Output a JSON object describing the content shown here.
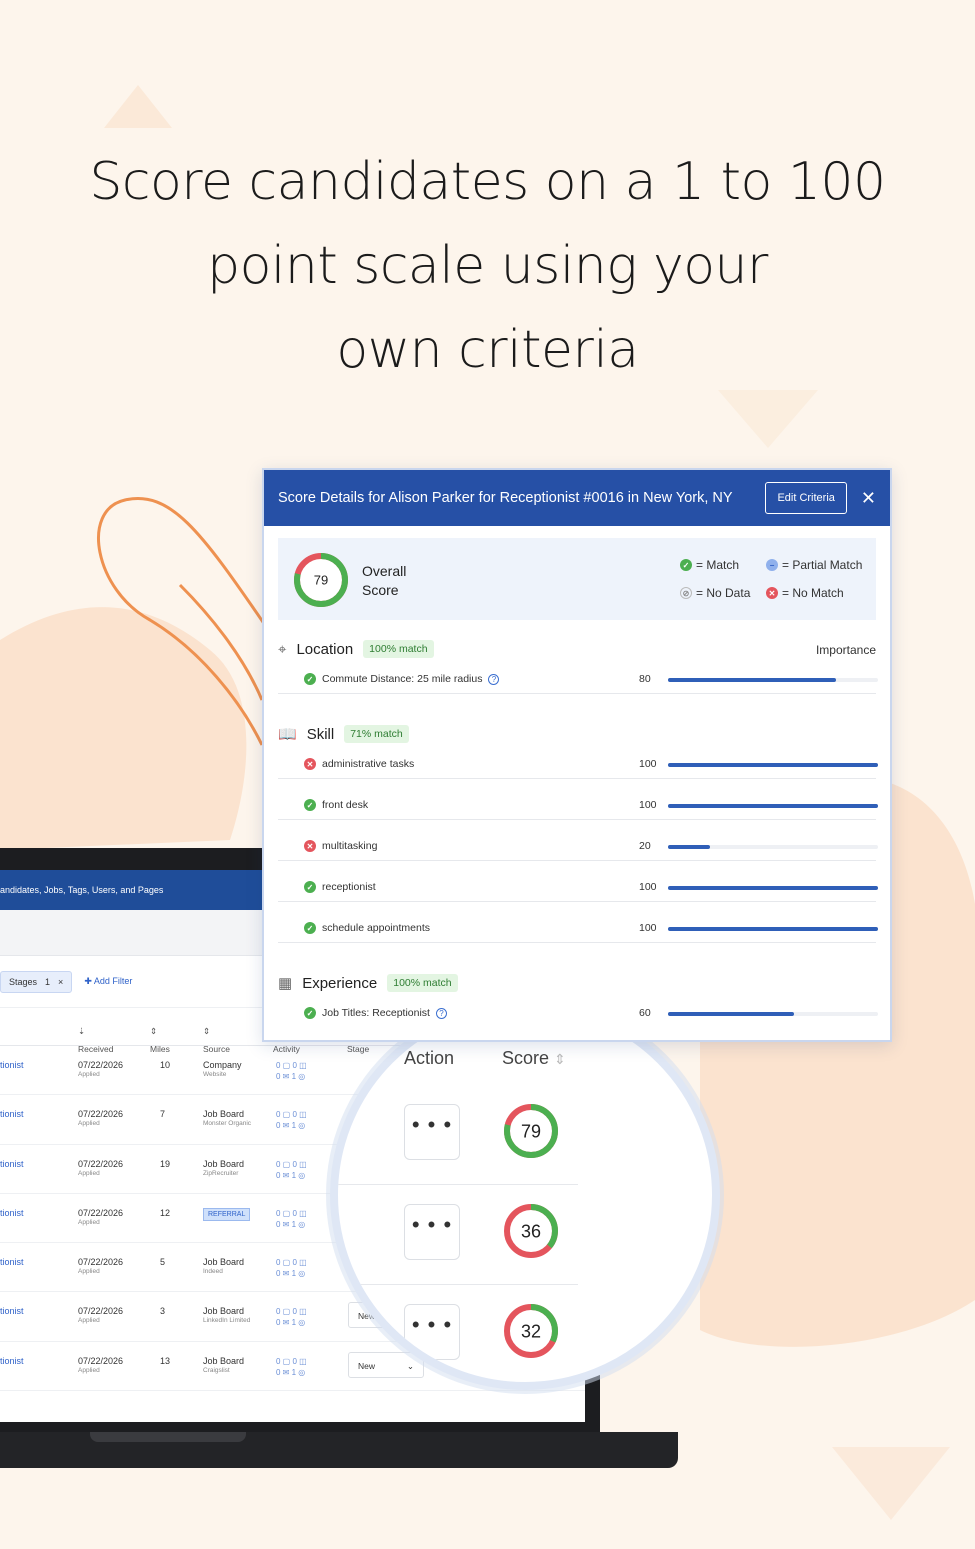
{
  "headline": {
    "line1": "Score candidates on a 1 to 100",
    "line2": "point scale using your",
    "line3": "own criteria"
  },
  "colors": {
    "primary": "#2650a6",
    "match": "#4caf50",
    "nomatch": "#e4555d",
    "background": "#fdf5ec",
    "accent_orange": "#ee9150"
  },
  "app": {
    "navbar_text": "andidates, Jobs, Tags, Users, and Pages",
    "linkedin_icon": "in",
    "filter_chip_label": "Stages",
    "filter_chip_count": "1",
    "filter_chip_close": "×",
    "add_filter": "Add Filter",
    "columns": {
      "received": "Received",
      "miles": "Miles",
      "source": "Source",
      "activity": "Activity",
      "stage": "Stage"
    },
    "rows": [
      {
        "job": "tionist",
        "date": "07/22/2026",
        "applied": "Applied",
        "miles": "10",
        "source": "Company",
        "source_sub": "Website",
        "stage": ""
      },
      {
        "job": "tionist",
        "date": "07/22/2026",
        "applied": "Applied",
        "miles": "7",
        "source": "Job Board",
        "source_sub": "Monster Organic",
        "stage": ""
      },
      {
        "job": "tionist",
        "date": "07/22/2026",
        "applied": "Applied",
        "miles": "19",
        "source": "Job Board",
        "source_sub": "ZipRecruiter",
        "stage": ""
      },
      {
        "job": "tionist",
        "date": "07/22/2026",
        "applied": "Applied",
        "miles": "12",
        "source": "REFERRAL",
        "source_sub": "",
        "stage": ""
      },
      {
        "job": "tionist",
        "date": "07/22/2026",
        "applied": "Applied",
        "miles": "5",
        "source": "Job Board",
        "source_sub": "Indeed",
        "stage": ""
      },
      {
        "job": "tionist",
        "date": "07/22/2026",
        "applied": "Applied",
        "miles": "3",
        "source": "Job Board",
        "source_sub": "LinkedIn Limited",
        "stage": "New"
      },
      {
        "job": "tionist",
        "date": "07/22/2026",
        "applied": "Applied",
        "miles": "13",
        "source": "Job Board",
        "source_sub": "Craigslist",
        "stage": "New"
      }
    ],
    "activity": {
      "a": "0",
      "b": "0",
      "c": "0",
      "d": "1"
    }
  },
  "magnifier": {
    "action_header": "Action",
    "score_header": "Score",
    "dots": "• • •",
    "scores": [
      {
        "value": "79",
        "fraction": 0.79
      },
      {
        "value": "36",
        "fraction": 0.36
      },
      {
        "value": "32",
        "fraction": 0.32
      }
    ]
  },
  "panel": {
    "title": "Score Details for Alison Parker for Receptionist #0016 in New York, NY",
    "edit_button": "Edit Criteria",
    "close": "✕",
    "overall_score": "79",
    "overall_fraction": 0.79,
    "overall_label1": "Overall",
    "overall_label2": "Score",
    "legend": {
      "match": "= Match",
      "partial": "= Partial Match",
      "nodata": "= No Data",
      "nomatch": "= No Match"
    },
    "importance_label": "Importance",
    "location": {
      "title": "Location",
      "badge": "100% match",
      "items": [
        {
          "label": "Commute Distance: 25 mile radius",
          "value": "80",
          "level": 0.8,
          "status": "match"
        }
      ]
    },
    "skill": {
      "title": "Skill",
      "badge": "71% match",
      "items": [
        {
          "label": "administrative tasks",
          "value": "100",
          "level": 1.0,
          "status": "nomatch"
        },
        {
          "label": "front desk",
          "value": "100",
          "level": 1.0,
          "status": "match"
        },
        {
          "label": "multitasking",
          "value": "20",
          "level": 0.2,
          "status": "nomatch"
        },
        {
          "label": "receptionist",
          "value": "100",
          "level": 1.0,
          "status": "match"
        },
        {
          "label": "schedule appointments",
          "value": "100",
          "level": 1.0,
          "status": "match"
        }
      ]
    },
    "experience": {
      "title": "Experience",
      "badge": "100% match",
      "items": [
        {
          "label": "Job Titles: Receptionist",
          "value": "60",
          "level": 0.6,
          "status": "match"
        }
      ]
    }
  }
}
